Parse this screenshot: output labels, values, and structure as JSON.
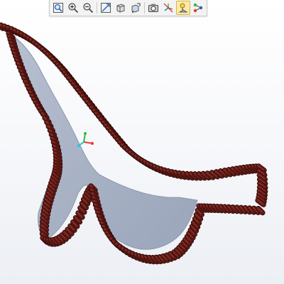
{
  "toolbar": {
    "buttons": [
      {
        "icon": "zoom-window-icon"
      },
      {
        "icon": "zoom-in-icon"
      },
      {
        "icon": "zoom-out-icon"
      },
      {
        "icon": "fit-all-icon"
      },
      {
        "icon": "view-orientation-icon"
      },
      {
        "icon": "display-style-icon"
      },
      {
        "icon": "camera-icon"
      },
      {
        "icon": "axis-hide-icon"
      },
      {
        "icon": "lighting-icon",
        "active": true
      },
      {
        "icon": "node-graph-icon"
      }
    ]
  },
  "colors": {
    "face": "#a7b1c4",
    "face_edge": "#8c97ab",
    "rod": "#5b1a16",
    "rod_highlight": "#8a2e27",
    "rod_shadow": "#2e0805",
    "axis_x": "#e53935",
    "axis_y": "#2ebd3a",
    "axis_z": "#26c6da"
  }
}
